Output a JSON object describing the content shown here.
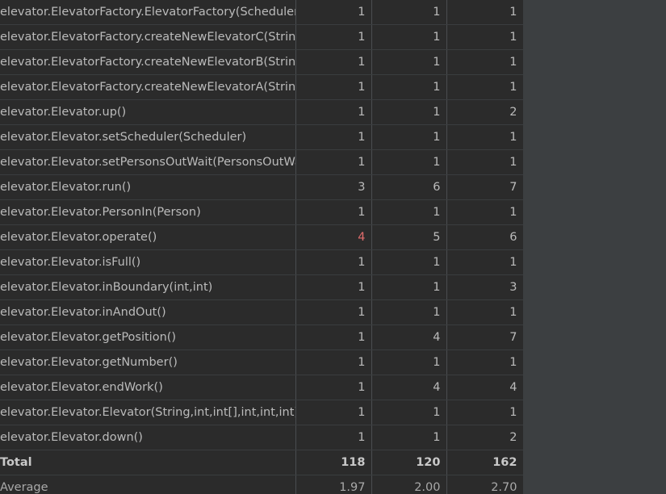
{
  "rows": [
    {
      "method": "elevator.ElevatorFactory.ElevatorFactory(Scheduler)",
      "a": "1",
      "b": "1",
      "c": "1"
    },
    {
      "method": "elevator.ElevatorFactory.createNewElevatorC(String)",
      "a": "1",
      "b": "1",
      "c": "1"
    },
    {
      "method": "elevator.ElevatorFactory.createNewElevatorB(String)",
      "a": "1",
      "b": "1",
      "c": "1"
    },
    {
      "method": "elevator.ElevatorFactory.createNewElevatorA(String)",
      "a": "1",
      "b": "1",
      "c": "1"
    },
    {
      "method": "elevator.Elevator.up()",
      "a": "1",
      "b": "1",
      "c": "2"
    },
    {
      "method": "elevator.Elevator.setScheduler(Scheduler)",
      "a": "1",
      "b": "1",
      "c": "1"
    },
    {
      "method": "elevator.Elevator.setPersonsOutWait(PersonsOutWait)",
      "a": "1",
      "b": "1",
      "c": "1"
    },
    {
      "method": "elevator.Elevator.run()",
      "a": "3",
      "b": "6",
      "c": "7"
    },
    {
      "method": "elevator.Elevator.PersonIn(Person)",
      "a": "1",
      "b": "1",
      "c": "1"
    },
    {
      "method": "elevator.Elevator.operate()",
      "a": "4",
      "b": "5",
      "c": "6",
      "a_color": "#e06c6c"
    },
    {
      "method": "elevator.Elevator.isFull()",
      "a": "1",
      "b": "1",
      "c": "1"
    },
    {
      "method": "elevator.Elevator.inBoundary(int,int)",
      "a": "1",
      "b": "1",
      "c": "3"
    },
    {
      "method": "elevator.Elevator.inAndOut()",
      "a": "1",
      "b": "1",
      "c": "1"
    },
    {
      "method": "elevator.Elevator.getPosition()",
      "a": "1",
      "b": "4",
      "c": "7"
    },
    {
      "method": "elevator.Elevator.getNumber()",
      "a": "1",
      "b": "1",
      "c": "1"
    },
    {
      "method": "elevator.Elevator.endWork()",
      "a": "1",
      "b": "4",
      "c": "4"
    },
    {
      "method": "elevator.Elevator.Elevator(String,int,int[],int,int,int)",
      "a": "1",
      "b": "1",
      "c": "1"
    },
    {
      "method": "elevator.Elevator.down()",
      "a": "1",
      "b": "1",
      "c": "2"
    }
  ],
  "total": {
    "label": "Total",
    "a": "118",
    "b": "120",
    "c": "162"
  },
  "average": {
    "label": "Average",
    "a": "1.97",
    "b": "2.00",
    "c": "2.70"
  },
  "colors": {
    "background": "#2b2b2b",
    "text": "#bbbbbb",
    "highlight": "#e06c6c",
    "panel": "#3c3f41"
  }
}
